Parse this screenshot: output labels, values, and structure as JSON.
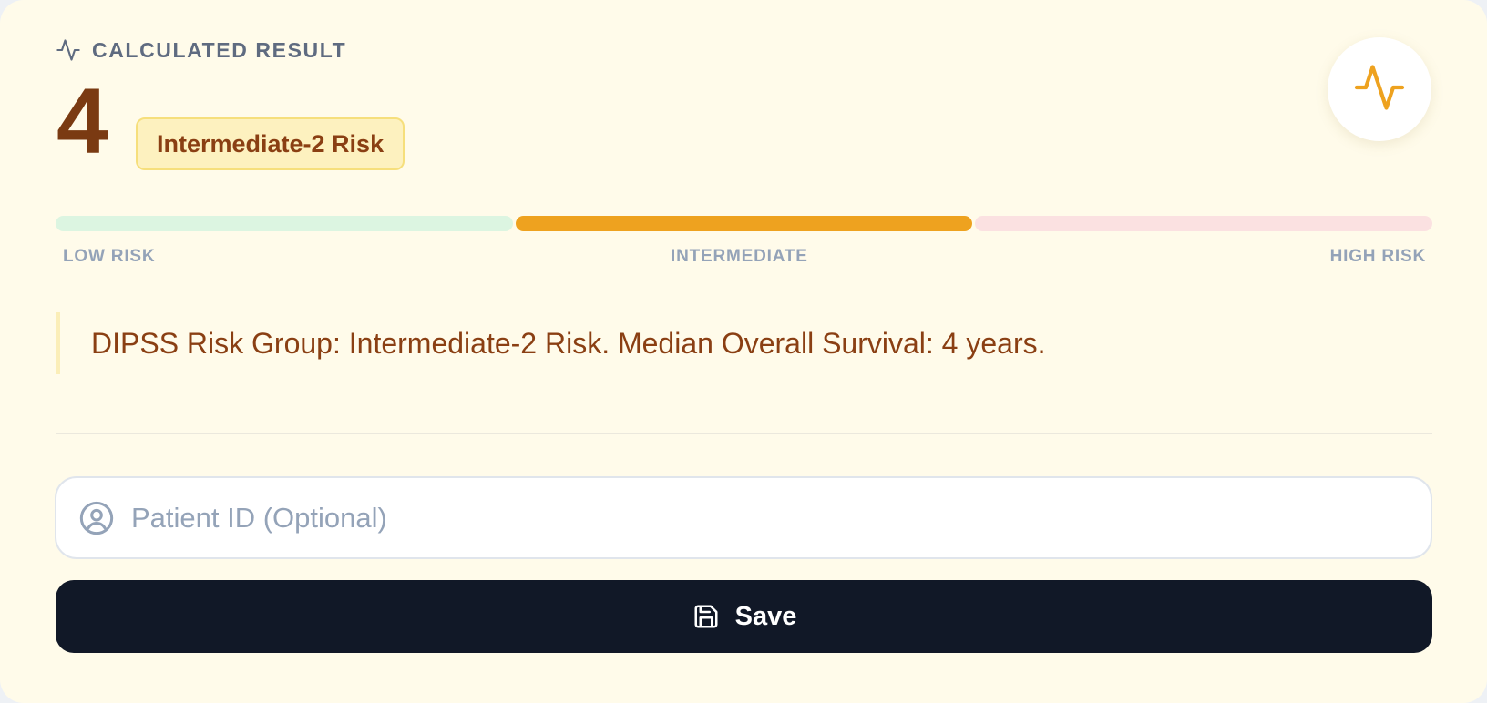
{
  "result": {
    "section_label": "CALCULATED RESULT",
    "score": "4",
    "risk_group": "Intermediate-2 Risk",
    "header_icon": "activity-icon",
    "badge_icon": "activity-icon",
    "accent_color": "#eea21f",
    "score_color": "#7a3a12"
  },
  "risk_scale": {
    "segments": [
      {
        "label": "LOW RISK",
        "color": "#dcf5e1",
        "active": false
      },
      {
        "label": "INTERMEDIATE",
        "color": "#eea21f",
        "active": true
      },
      {
        "label": "HIGH RISK",
        "color": "#fbe1e1",
        "active": false
      }
    ]
  },
  "interpretation": "DIPSS Risk Group: Intermediate-2 Risk. Median Overall Survival: 4 years.",
  "patient_id": {
    "placeholder": "Patient ID (Optional)",
    "value": "",
    "icon": "user-circle-icon"
  },
  "save": {
    "label": "Save",
    "icon": "save-icon",
    "background": "#111827"
  }
}
